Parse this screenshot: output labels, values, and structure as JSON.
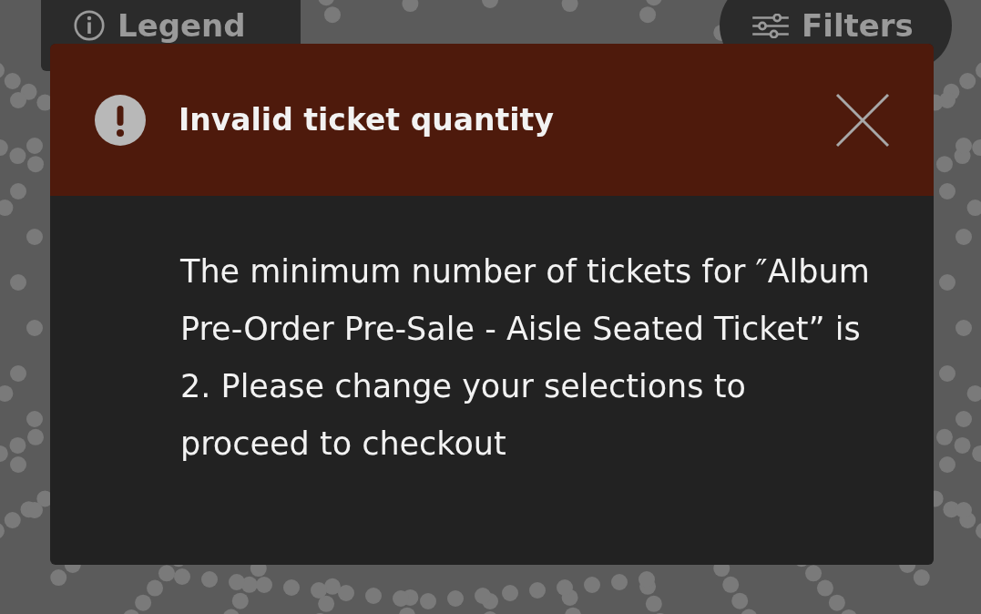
{
  "toolbar": {
    "legend_button": {
      "label": "Legend"
    },
    "filters_button": {
      "label": "Filters"
    }
  },
  "dialog": {
    "title": "Invalid ticket quantity",
    "message": "The minimum number of tickets for ″Album Pre-Order Pre-Sale - Aisle Seated Ticket” is 2. Please change your selections to proceed to checkout"
  }
}
